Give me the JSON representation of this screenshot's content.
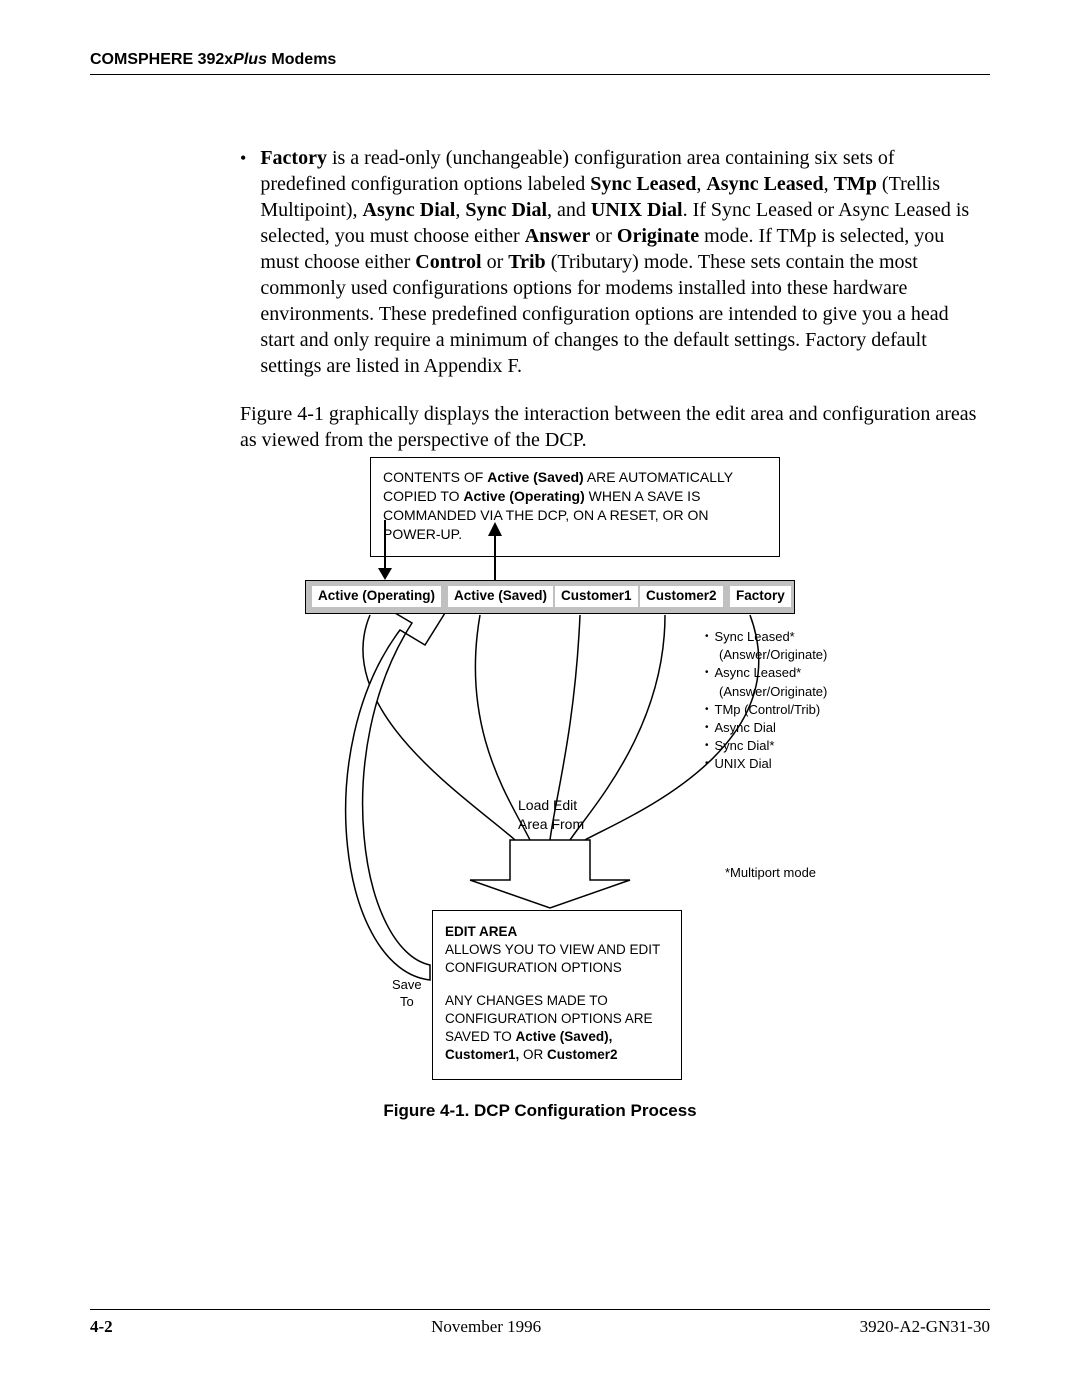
{
  "header": {
    "title_prefix": "COMSPHERE 392x",
    "title_italic": "Plus",
    "title_suffix": " Modems"
  },
  "body": {
    "bullet_lead_bold": "Factory",
    "bullet_text_1": " is a read-only (unchangeable) configuration area containing six sets of predefined configuration options labeled ",
    "sync_leased": "Sync Leased",
    "comma1": ", ",
    "async_leased": "Async Leased",
    "comma2": ", ",
    "tmp": "TMp",
    "after_tmp": " (Trellis Multipoint), ",
    "async_dial": "Async Dial",
    "comma3": ", ",
    "sync_dial": "Sync Dial",
    "and": ", and ",
    "unix_dial": "UNIX Dial",
    "after_unix": ". If Sync Leased or Async Leased is selected, you must choose either ",
    "answer": "Answer",
    "or1": " or ",
    "originate": "Originate",
    "after_originate": " mode. If TMp is selected, you must choose either ",
    "control": "Control",
    "or2": " or ",
    "trib": "Trib",
    "after_trib": " (Tributary) mode. These sets contain the most commonly used configurations options for modems installed into these hardware environments. These predefined configuration options are intended to give you a head start and only require a minimum of changes to the default settings. Factory default settings are listed in Appendix F.",
    "para2": "Figure 4-1 graphically displays the interaction between the edit area and configuration areas as viewed from the perspective of the DCP."
  },
  "figure": {
    "top_box_1a": "CONTENTS OF ",
    "top_box_1b": "Active (Saved)",
    "top_box_1c": " ARE AUTOMATICALLY COPIED TO ",
    "top_box_2b": "Active (Operating)",
    "top_box_2c": " WHEN A SAVE IS COMMANDED VIA THE DCP, ON A RESET, OR ON POWER-UP.",
    "areas": {
      "active_operating": "Active (Operating)",
      "active_saved": "Active (Saved)",
      "customer1": "Customer1",
      "customer2": "Customer2",
      "factory": "Factory"
    },
    "factory_list": [
      {
        "label": "Sync Leased*",
        "sub": "(Answer/Originate)"
      },
      {
        "label": "Async Leased*",
        "sub": "(Answer/Originate)"
      },
      {
        "label": "TMp (Control/Trib)",
        "sub": ""
      },
      {
        "label": "Async Dial",
        "sub": ""
      },
      {
        "label": "Sync Dial*",
        "sub": ""
      },
      {
        "label": "UNIX Dial",
        "sub": ""
      }
    ],
    "multiport_note": "*Multiport mode",
    "load_label_l1": "Load Edit",
    "load_label_l2": "Area From",
    "save_label_l1": "Save",
    "save_label_l2": "To",
    "edit_box_title": "EDIT AREA",
    "edit_box_p1": "ALLOWS YOU TO VIEW AND EDIT CONFIGURATION OPTIONS",
    "edit_box_p2a": "ANY CHANGES MADE TO CONFIGURATION OPTIONS ARE SAVED TO ",
    "edit_box_p2b": "Active (Saved), Customer1,",
    "edit_box_p2c": " OR ",
    "edit_box_p2d": "Customer2",
    "caption": "Figure 4-1.  DCP Configuration Process"
  },
  "footer": {
    "page": "4-2",
    "date": "November 1996",
    "docnum": "3920-A2-GN31-30"
  }
}
